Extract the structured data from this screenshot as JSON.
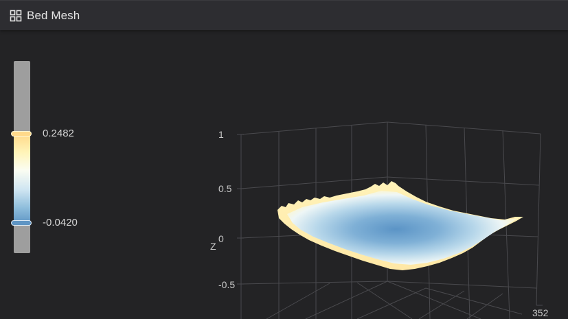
{
  "header": {
    "title": "Bed Mesh",
    "icon": "grid-icon"
  },
  "scale": {
    "max_label": "0.2482",
    "min_label": "-0.0420",
    "colors": {
      "high": "#ffd98a",
      "mid_high": "#fff4b8",
      "mid": "#fbfdf2",
      "mid_low": "#cfe5f2",
      "low": "#5f95c4"
    }
  },
  "plot": {
    "z_axis_title": "Z",
    "z_ticks": [
      "1",
      "0.5",
      "0",
      "-0.5"
    ],
    "corner_tick": "352"
  },
  "theme": {
    "background": "#232325",
    "header_bg": "#2d2d31",
    "text": "#e4e4e4",
    "grid": "#4a4a4e"
  }
}
